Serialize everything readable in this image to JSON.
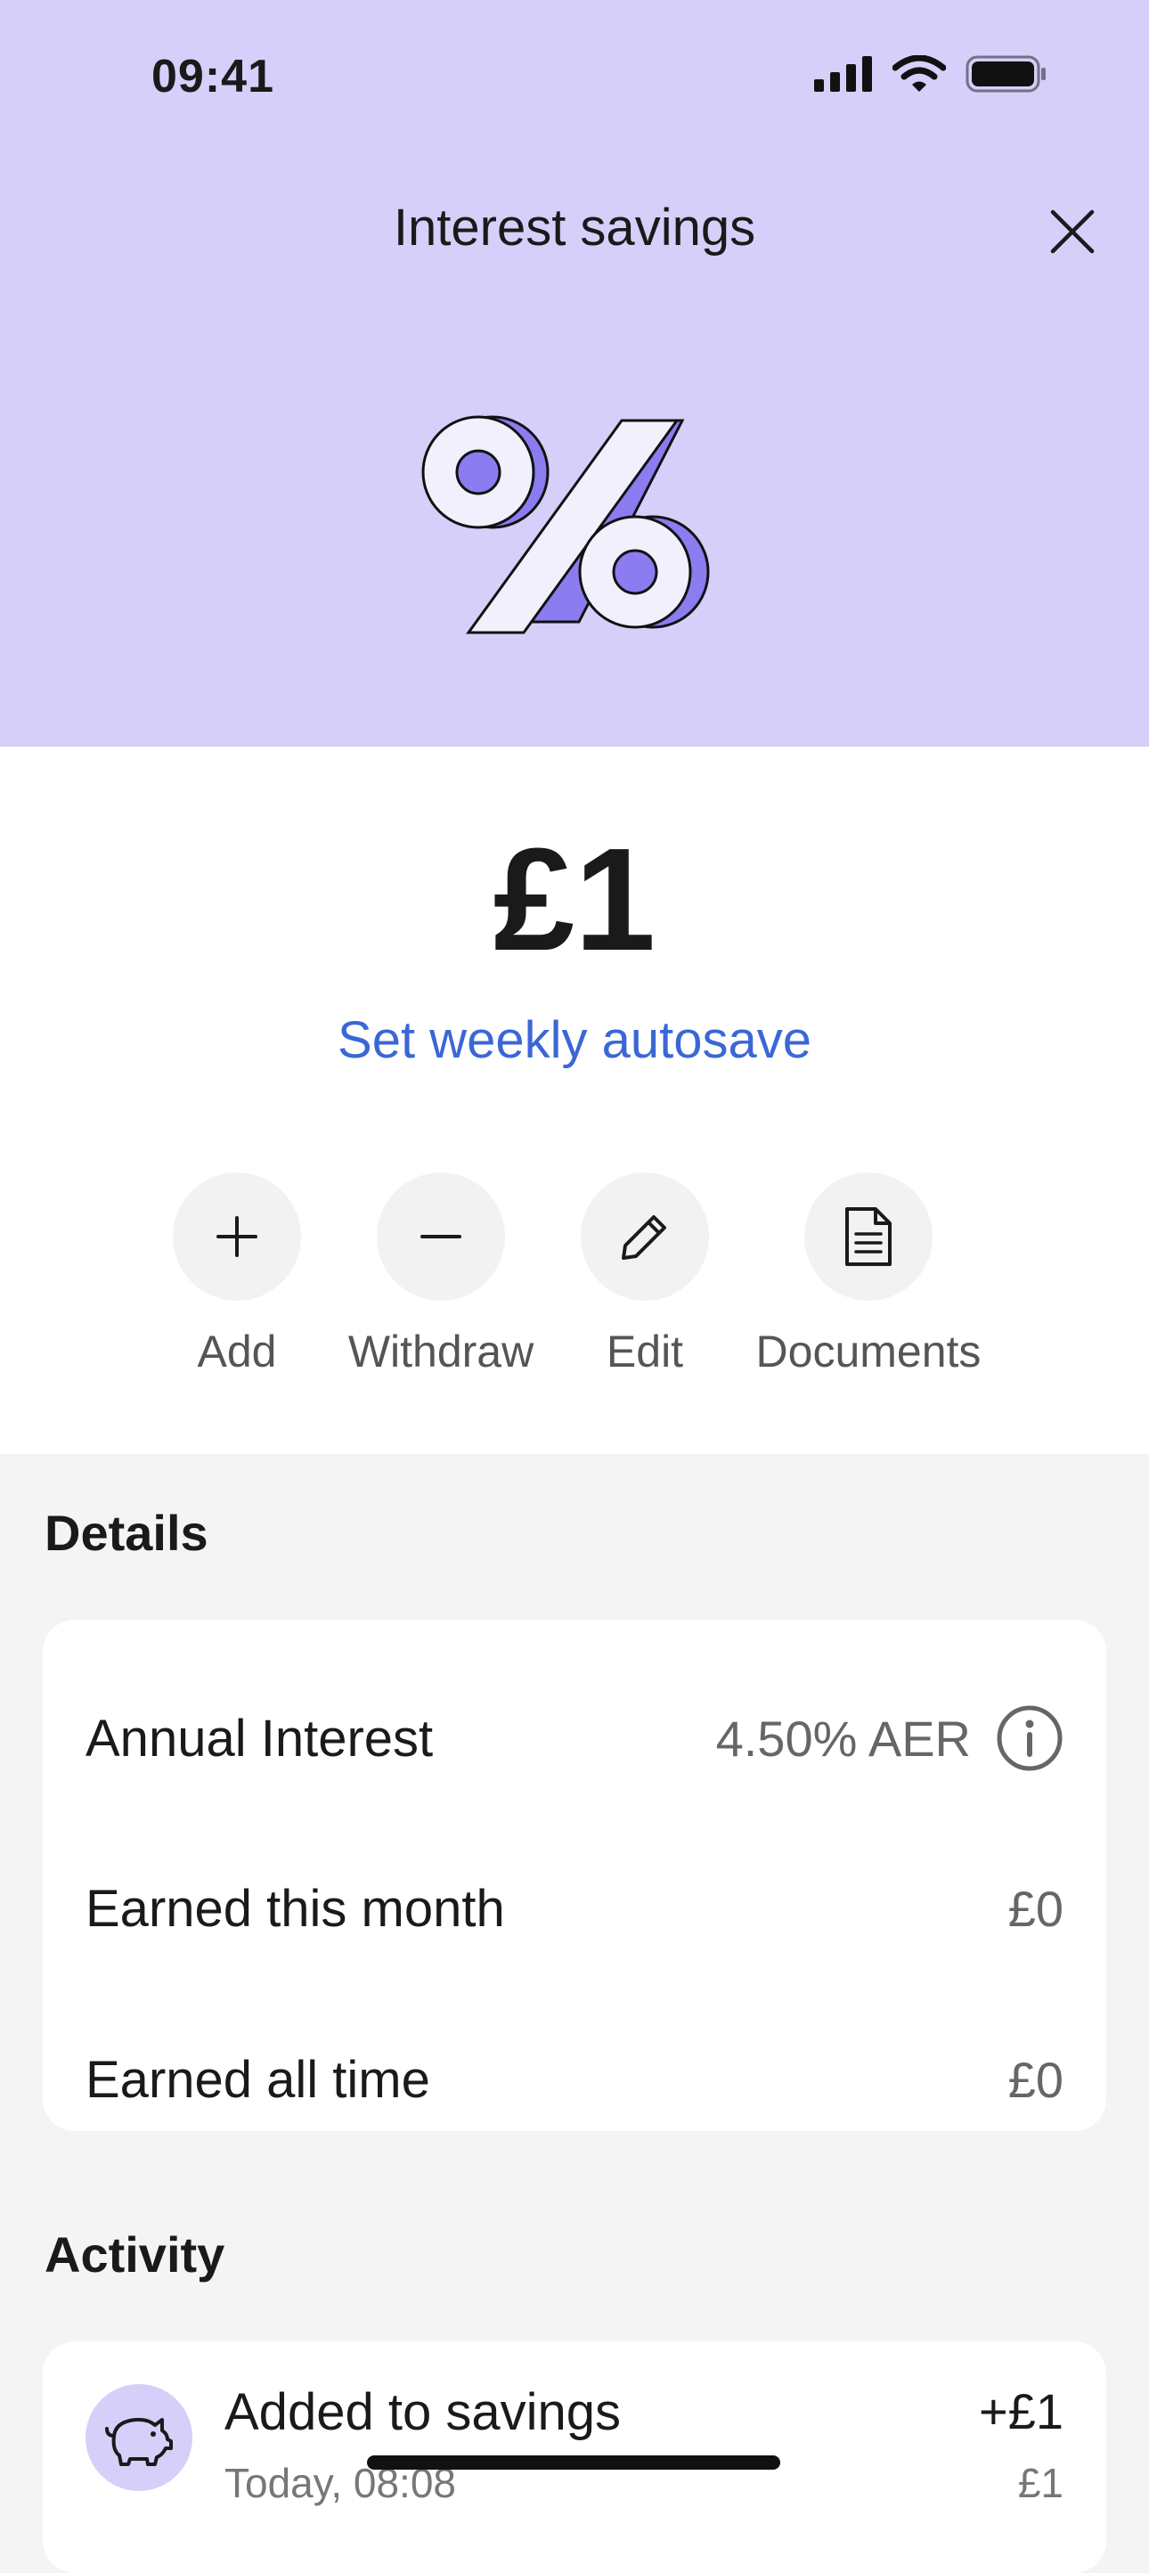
{
  "status_bar": {
    "time": "09:41"
  },
  "header": {
    "title": "Interest savings"
  },
  "icons": {
    "close": "close-icon",
    "illustration": "percent-icon",
    "add": "plus-icon",
    "withdraw": "minus-icon",
    "edit": "pencil-icon",
    "documents": "document-icon",
    "info": "info-icon",
    "activity": "piggy-bank-icon"
  },
  "balance": {
    "amount": "£1"
  },
  "autosave": {
    "label": "Set weekly autosave"
  },
  "actions": [
    {
      "label": "Add"
    },
    {
      "label": "Withdraw"
    },
    {
      "label": "Edit"
    },
    {
      "label": "Documents"
    }
  ],
  "details": {
    "heading": "Details",
    "rows": [
      {
        "label": "Annual Interest",
        "value": "4.50% AER"
      },
      {
        "label": "Earned this month",
        "value": "£0"
      },
      {
        "label": "Earned all time",
        "value": "£0"
      }
    ]
  },
  "activity": {
    "heading": "Activity",
    "items": [
      {
        "title": "Added to savings",
        "subtitle": "Today, 08:08",
        "amount": "+£1",
        "balance": "£1"
      }
    ]
  },
  "colors": {
    "hero_bg": "#d6cffa",
    "accent_purple": "#8b7cf0",
    "link_blue": "#3b67d6",
    "page_bg": "#f4f4f4"
  }
}
